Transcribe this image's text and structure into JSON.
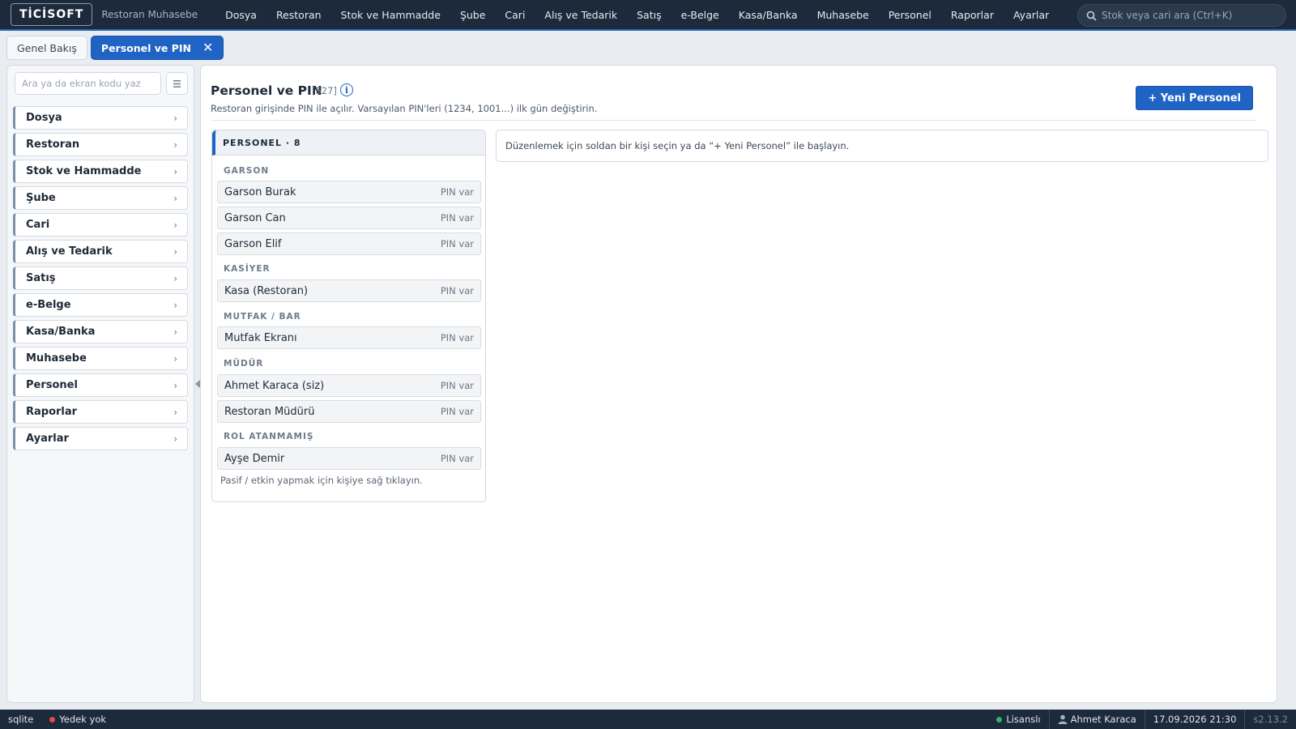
{
  "header": {
    "logo": "TİCİSOFT",
    "app_name": "Restoran Muhasebe",
    "menu": [
      "Dosya",
      "Restoran",
      "Stok ve Hammadde",
      "Şube",
      "Cari",
      "Alış ve Tedarik",
      "Satış",
      "e-Belge",
      "Kasa/Banka",
      "Muhasebe",
      "Personel",
      "Raporlar",
      "Ayarlar"
    ],
    "search_placeholder": "Stok veya cari ara (Ctrl+K)"
  },
  "tabs": {
    "overview": "Genel Bakış",
    "active": "Personel ve PIN",
    "close_glyph": "✕"
  },
  "sidebar": {
    "search_placeholder": "Ara ya da ekran kodu yaz",
    "items": [
      "Dosya",
      "Restoran",
      "Stok ve Hammadde",
      "Şube",
      "Cari",
      "Alış ve Tedarik",
      "Satış",
      "e-Belge",
      "Kasa/Banka",
      "Muhasebe",
      "Personel",
      "Raporlar",
      "Ayarlar"
    ]
  },
  "page": {
    "title": "Personel ve PIN",
    "code": "[527]",
    "info_glyph": "i",
    "subtitle": "Restoran girişinde PIN ile açılır. Varsayılan PIN'leri (1234, 1001...) ilk gün değiştirin.",
    "new_button": "+ Yeni Personel"
  },
  "staff": {
    "header": "PERSONEL · 8",
    "groups": [
      {
        "label": "GARSON",
        "members": [
          {
            "name": "Garson Burak",
            "pin": "PIN var"
          },
          {
            "name": "Garson Can",
            "pin": "PIN var"
          },
          {
            "name": "Garson Elif",
            "pin": "PIN var"
          }
        ]
      },
      {
        "label": "KASİYER",
        "members": [
          {
            "name": "Kasa (Restoran)",
            "pin": "PIN var"
          }
        ]
      },
      {
        "label": "MUTFAK / BAR",
        "members": [
          {
            "name": "Mutfak Ekranı",
            "pin": "PIN var"
          }
        ]
      },
      {
        "label": "MÜDÜR",
        "members": [
          {
            "name": "Ahmet Karaca (siz)",
            "pin": "PIN var"
          },
          {
            "name": "Restoran Müdürü",
            "pin": "PIN var"
          }
        ]
      },
      {
        "label": "ROL ATANMAMIŞ",
        "members": [
          {
            "name": "Ayşe Demir",
            "pin": "PIN var"
          }
        ]
      }
    ],
    "hint": "Pasif / etkin yapmak için kişiye sağ tıklayın."
  },
  "detail": {
    "placeholder": "Düzenlemek için soldan bir kişi seçin ya da “+ Yeni Personel” ile başlayın."
  },
  "status": {
    "db": "sqlite",
    "backup": "Yedek yok",
    "backup_color": "#e5484d",
    "license": "Lisanslı",
    "license_color": "#2fb36a",
    "user": "Ahmet Karaca",
    "datetime": "17.09.2026 21:30",
    "version": "s2.13.2"
  }
}
